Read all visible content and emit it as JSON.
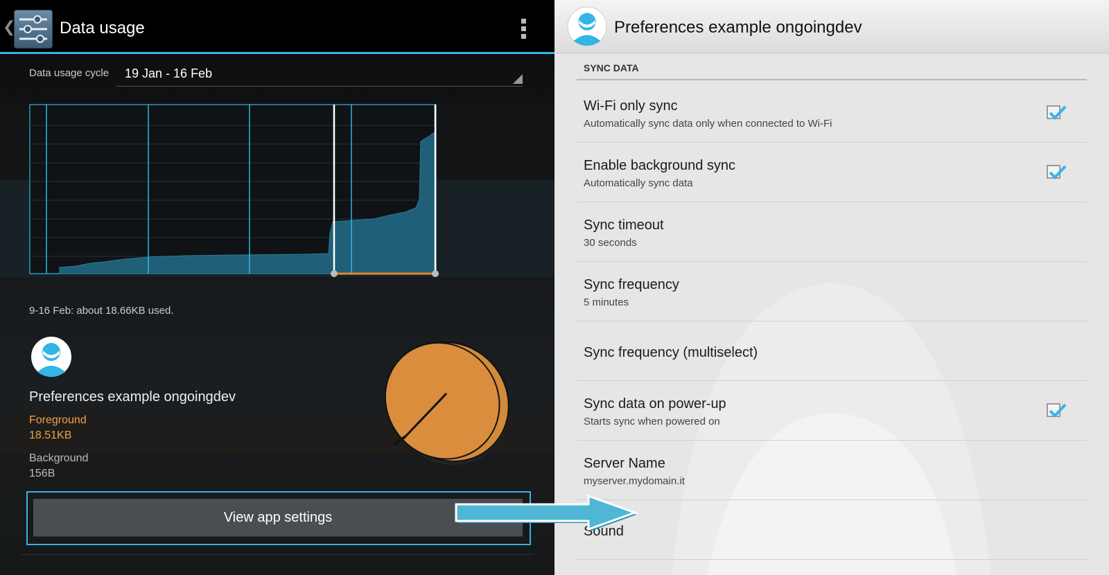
{
  "left": {
    "actionbar": {
      "title": "Data usage",
      "icon": "settings-sliders-icon"
    },
    "cycle": {
      "label": "Data usage cycle",
      "value": "19 Jan - 16 Feb"
    },
    "usage_summary": "9-16 Feb: about 18.66KB used.",
    "app": {
      "name": "Preferences example ongoingdev",
      "foreground_label": "Foreground",
      "foreground_value": "18.51KB",
      "background_label": "Background",
      "background_value": "156B"
    },
    "view_app_settings": "View app settings"
  },
  "right": {
    "actionbar": {
      "title": "Preferences example ongoingdev"
    },
    "section_header": "SYNC DATA",
    "prefs": [
      {
        "title": "Wi-Fi only sync",
        "summary": "Automatically sync data only when connected to Wi-Fi",
        "checked": true
      },
      {
        "title": "Enable background sync",
        "summary": "Automatically sync data",
        "checked": true
      },
      {
        "title": "Sync timeout",
        "summary": "30 seconds"
      },
      {
        "title": "Sync frequency",
        "summary": "5 minutes"
      },
      {
        "title": "Sync frequency (multiselect)"
      },
      {
        "title": "Sync data on power-up",
        "summary": "Starts sync when powered on",
        "checked": true
      },
      {
        "title": "Server Name",
        "summary": "myserver.mydomain.it"
      },
      {
        "title": "Sound"
      }
    ]
  },
  "colors": {
    "accent": "#33b5e5",
    "foreground_orange": "#f0a346",
    "chart_fill": "#1f5f78",
    "left_bg": "#141619",
    "right_bg": "#e6e6e6"
  }
}
